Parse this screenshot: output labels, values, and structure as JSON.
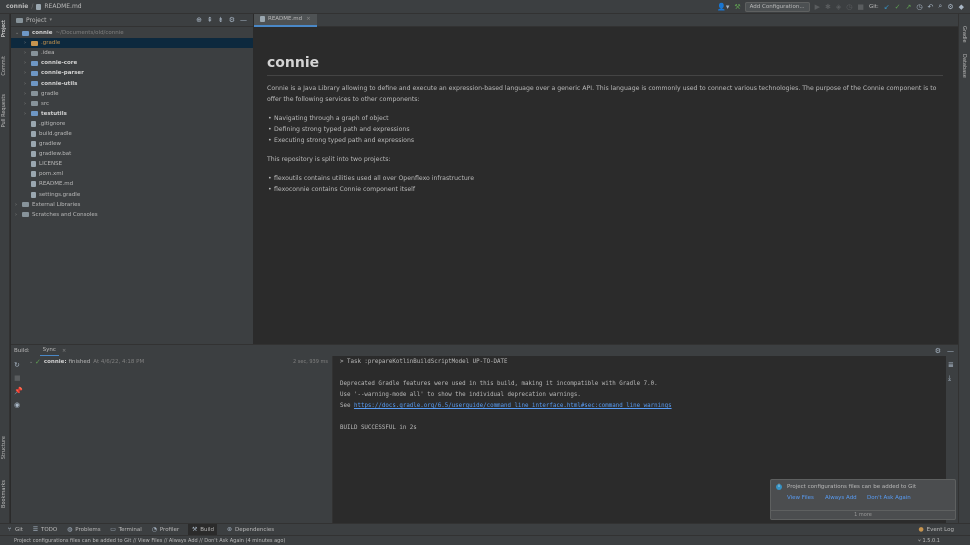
{
  "titlebar": {
    "project": "connie",
    "file": "README.md",
    "run_config": "Add Configuration...",
    "git_label": "Git:"
  },
  "left_stripe": {
    "project": "Project",
    "commit": "Commit",
    "pull_requests": "Pull Requests",
    "structure": "Structure",
    "bookmarks": "Bookmarks"
  },
  "right_stripe": {
    "gradle": "Gradle",
    "database": "Database"
  },
  "project_panel": {
    "title": "Project",
    "items": [
      {
        "label": "connie",
        "suffix": "~/Documents/old/connie",
        "depth": 0,
        "arrow": "⌄",
        "icon": "folder-blue",
        "bold": true
      },
      {
        "label": ".gradle",
        "depth": 1,
        "arrow": "›",
        "icon": "folder-orange",
        "style": "ignored",
        "selected": true
      },
      {
        "label": ".idea",
        "depth": 1,
        "arrow": "›",
        "icon": "folder"
      },
      {
        "label": "connie-core",
        "depth": 1,
        "arrow": "›",
        "icon": "folder-blue",
        "bold": true
      },
      {
        "label": "connie-parser",
        "depth": 1,
        "arrow": "›",
        "icon": "folder-blue",
        "bold": true
      },
      {
        "label": "connie-utils",
        "depth": 1,
        "arrow": "›",
        "icon": "folder-blue",
        "bold": true
      },
      {
        "label": "gradle",
        "depth": 1,
        "arrow": "›",
        "icon": "folder"
      },
      {
        "label": "src",
        "depth": 1,
        "arrow": "›",
        "icon": "folder"
      },
      {
        "label": "testutils",
        "depth": 1,
        "arrow": "›",
        "icon": "folder-blue",
        "bold": true
      },
      {
        "label": ".gitignore",
        "depth": 1,
        "icon": "file"
      },
      {
        "label": "build.gradle",
        "depth": 1,
        "icon": "file"
      },
      {
        "label": "gradlew",
        "depth": 1,
        "icon": "file"
      },
      {
        "label": "gradlew.bat",
        "depth": 1,
        "icon": "file"
      },
      {
        "label": "LICENSE",
        "depth": 1,
        "icon": "file"
      },
      {
        "label": "pom.xml",
        "depth": 1,
        "icon": "file"
      },
      {
        "label": "README.md",
        "depth": 1,
        "icon": "file"
      },
      {
        "label": "settings.gradle",
        "depth": 1,
        "icon": "file"
      },
      {
        "label": "External Libraries",
        "depth": 0,
        "arrow": "›",
        "icon": "folder"
      },
      {
        "label": "Scratches and Consoles",
        "depth": 0,
        "arrow": "›",
        "icon": "folder"
      }
    ]
  },
  "editor": {
    "tab": "README.md",
    "title": "connie",
    "p1": "Connie is a Java Library allowing to define and execute an expression-based language over a generic API. This language is commonly used to connect various technologies. The purpose of the Connie component is to offer the following services to other components:",
    "list1": [
      "Navigating through a graph of object",
      "Defining strong typed path and expressions",
      "Executing strong typed path and expressions"
    ],
    "p2": "This repository is split into two projects:",
    "list2": [
      "flexoutils contains utilities used all over Openflexo infrastructure",
      "flexoconnie contains Connie component itself"
    ]
  },
  "build": {
    "label": "Build:",
    "tab": "Sync",
    "entry_name": "connie:",
    "entry_status": "finished",
    "entry_time": "At 4/6/22, 4:18 PM",
    "entry_duration": "2 sec, 939 ms",
    "console": {
      "line1": "> Task :prepareKotlinBuildScriptModel UP-TO-DATE",
      "line2": "Deprecated Gradle features were used in this build, making it incompatible with Gradle 7.0.",
      "line3": "Use '--warning-mode all' to show the individual deprecation warnings.",
      "line4_prefix": "See ",
      "line4_link": "https://docs.gradle.org/6.5/userguide/command_line_interface.html#sec:command_line_warnings",
      "line5": "BUILD SUCCESSFUL in 2s"
    }
  },
  "notification": {
    "message": "Project configurations files can be added to Git",
    "view_files": "View Files",
    "always_add": "Always Add",
    "dont_ask": "Don't Ask Again",
    "more": "1 more"
  },
  "bottombar": {
    "git": "Git",
    "todo": "TODO",
    "problems": "Problems",
    "terminal": "Terminal",
    "profiler": "Profiler",
    "build": "Build",
    "dependencies": "Dependencies",
    "event_log": "Event Log"
  },
  "statusbar": {
    "message": "Project configurations files can be added to Git // View Files // Always Add // Don't Ask Again (4 minutes ago)",
    "branch": "1.5.0.1"
  },
  "colors": {
    "accent": "#4a88c7",
    "link": "#589df6",
    "panel": "#3c3f41",
    "editor_bg": "#2b2b2b"
  }
}
